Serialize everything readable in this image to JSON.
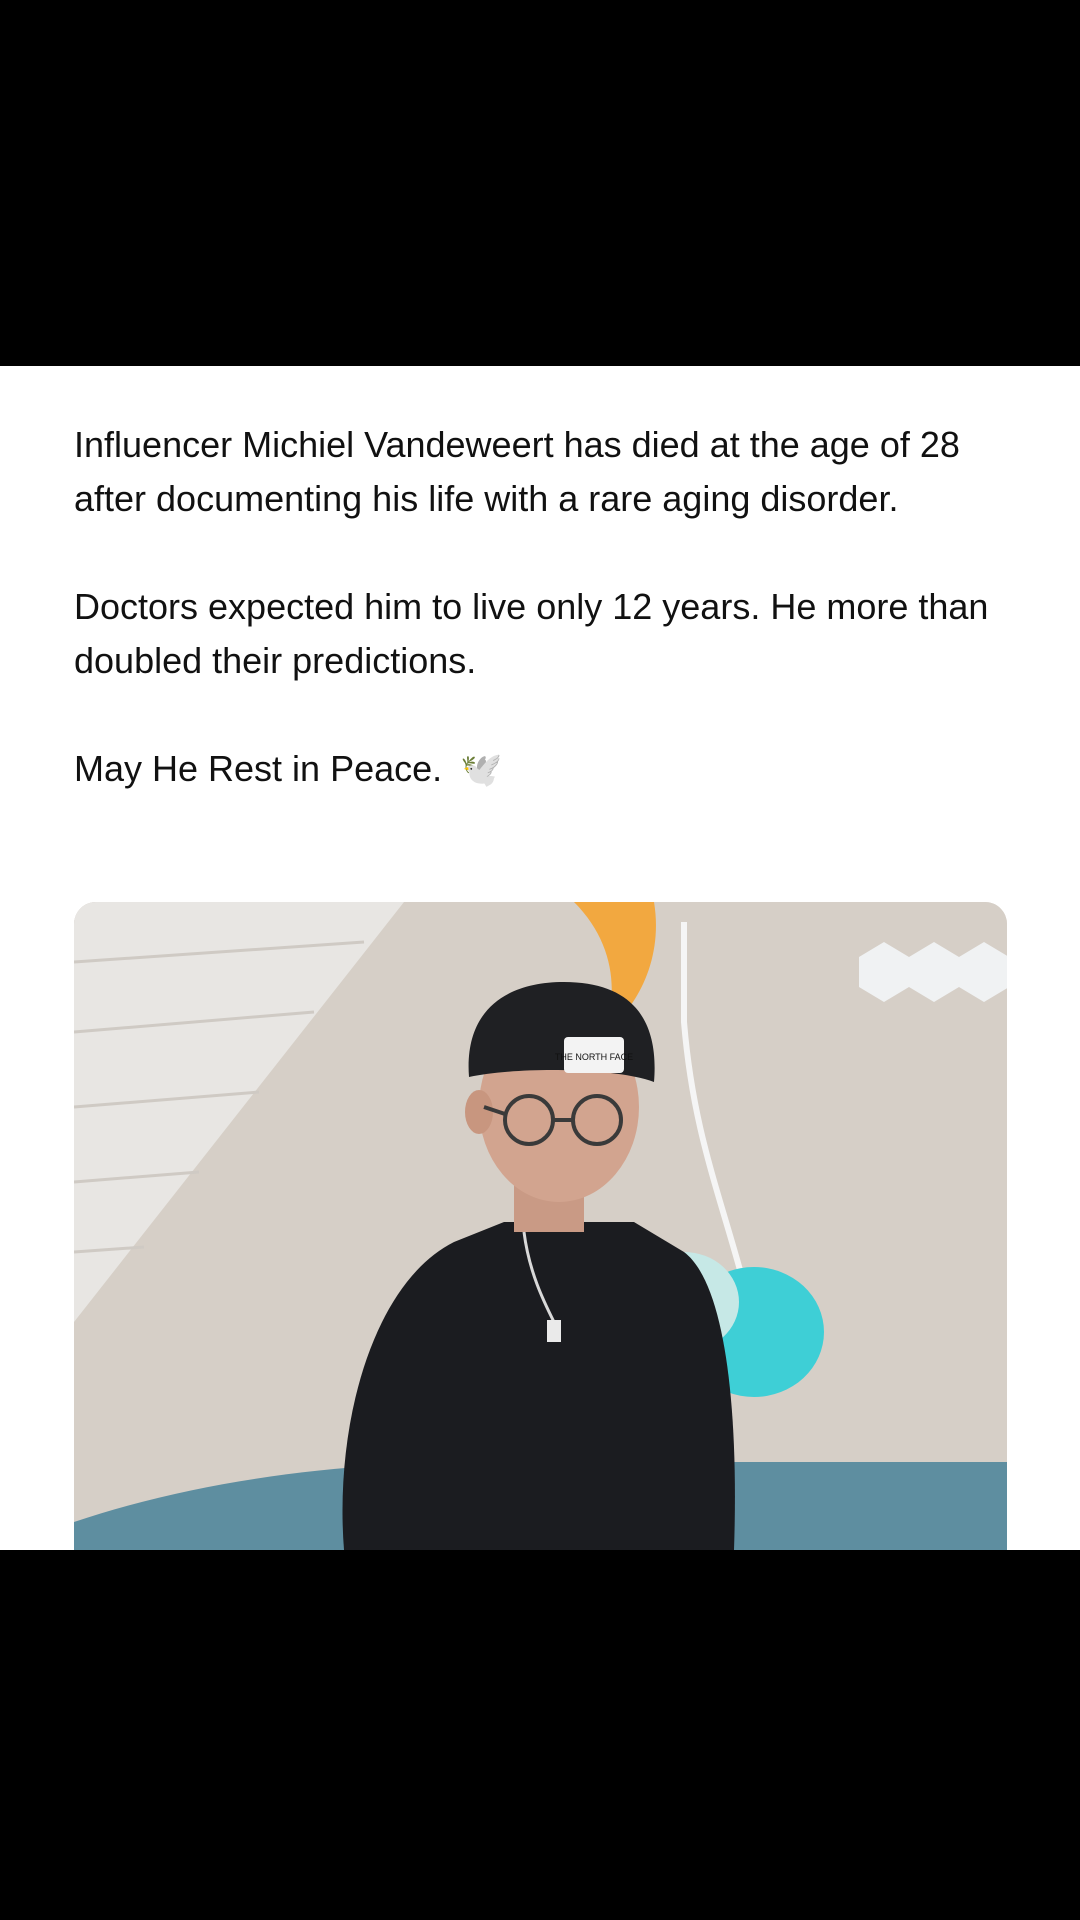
{
  "post": {
    "paragraphs": [
      "Influencer Michiel Vandeweert has died at the age of 28 after documenting his life with a rare aging disorder.",
      "Doctors expected him to live only 12 years. He more than doubled their predictions.",
      "May He Rest in Peace."
    ],
    "emoji": "🕊️",
    "image": {
      "hat_text": "THE NORTH FACE"
    }
  }
}
